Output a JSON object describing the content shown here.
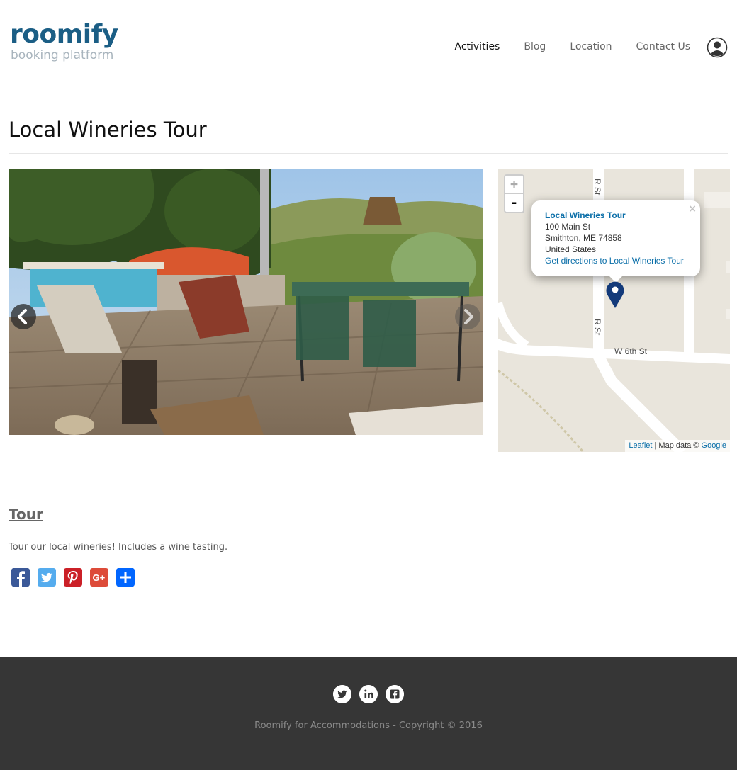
{
  "brand": {
    "name": "roomify",
    "tagline": "booking platform",
    "color": "#1b5e85"
  },
  "nav": {
    "items": [
      {
        "label": "Activities",
        "active": true
      },
      {
        "label": "Blog",
        "active": false
      },
      {
        "label": "Location",
        "active": false
      },
      {
        "label": "Contact Us",
        "active": false
      }
    ],
    "user_icon": "user-circle-icon"
  },
  "page": {
    "title": "Local Wineries Tour"
  },
  "carousel": {
    "prev_icon": "chevron-left-icon",
    "next_icon": "chevron-right-icon"
  },
  "map": {
    "zoom_in": "+",
    "zoom_out": "-",
    "streets": [
      "R St",
      "R St",
      "W 6th St"
    ],
    "popup": {
      "close": "×",
      "title": "Local Wineries Tour",
      "address_line1": "100 Main St",
      "address_line2": "Smithton, ME 74858",
      "address_line3": "United States",
      "directions_link": "Get directions to Local Wineries Tour"
    },
    "attribution": {
      "leaflet": "Leaflet",
      "separator": " | Map data © ",
      "google": "Google"
    }
  },
  "section": {
    "title": "Tour",
    "description": "Tour our local wineries!  Includes a wine tasting."
  },
  "share": [
    {
      "name": "facebook-share-icon",
      "color": "#3b5998"
    },
    {
      "name": "twitter-share-icon",
      "color": "#55acee"
    },
    {
      "name": "pinterest-share-icon",
      "color": "#cb2027"
    },
    {
      "name": "google-plus-share-icon",
      "color": "#dd4b39"
    },
    {
      "name": "addtoany-share-icon",
      "color": "#0166ff",
      "glyph": "+"
    }
  ],
  "footer": {
    "icons": [
      "twitter-icon",
      "linkedin-icon",
      "facebook-icon"
    ],
    "copyright": "Roomify for Accommodations - Copyright © 2016",
    "background": "#363636"
  }
}
